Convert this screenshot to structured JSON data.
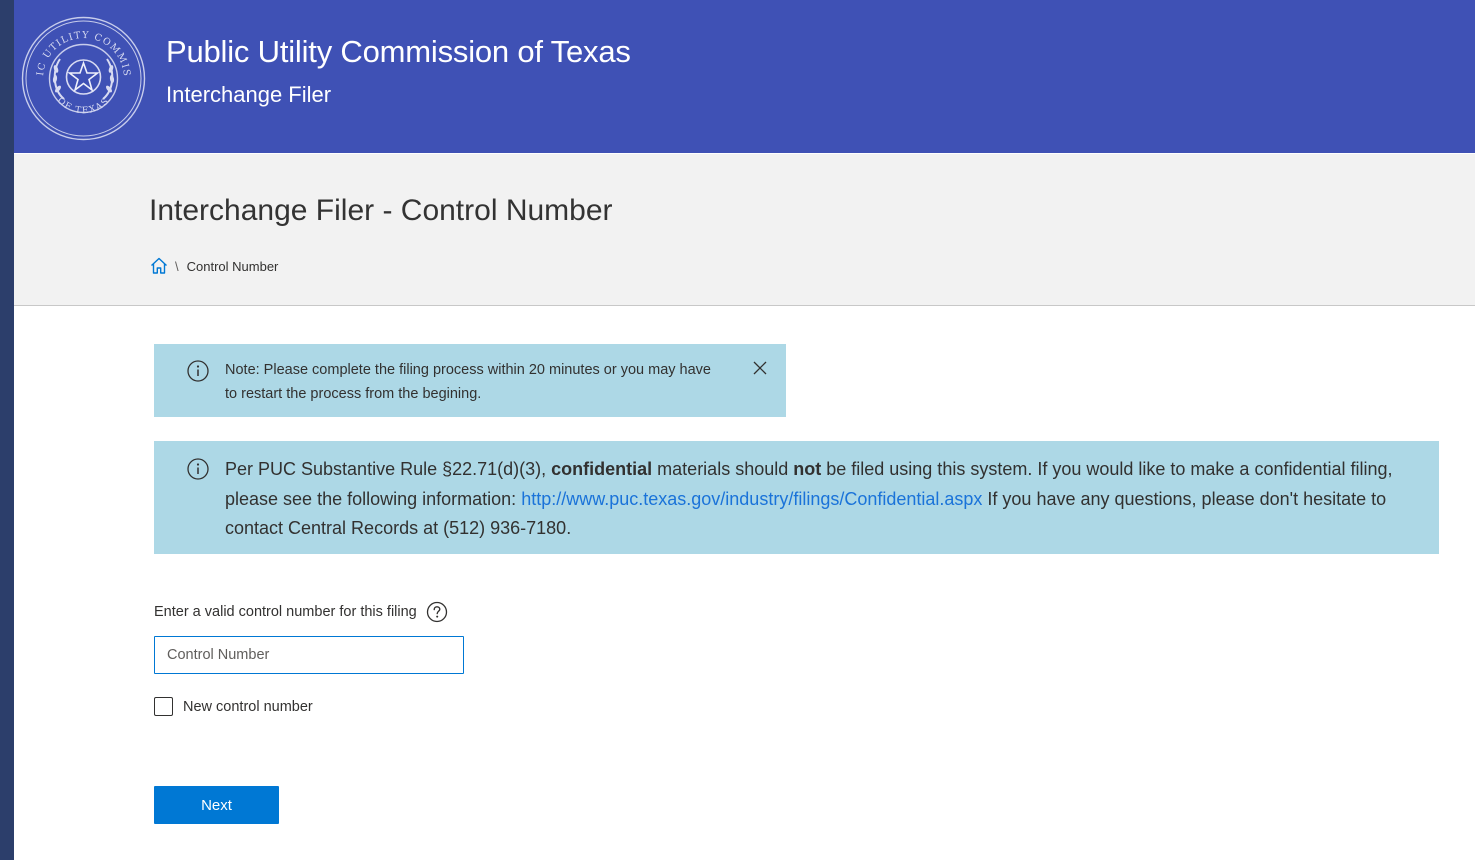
{
  "header": {
    "title": "Public Utility Commission of Texas",
    "subtitle": "Interchange Filer",
    "seal": {
      "icon": "state-seal-icon",
      "top_text": "PUBLIC UTILITY COMMISSION",
      "bottom_text": "OF TEXAS"
    }
  },
  "page": {
    "title": "Interchange Filer - Control Number",
    "breadcrumb": {
      "home_icon": "home-icon",
      "separator": "\\",
      "current": "Control Number"
    }
  },
  "notices": {
    "timeout": {
      "icon": "info-icon",
      "text": "Note: Please complete the filing process within 20 minutes or you may have to restart the process from the begining.",
      "close_icon": "close-icon"
    },
    "confidential": {
      "icon": "info-icon",
      "part1": "Per PUC Substantive Rule §22.71(d)(3), ",
      "bold1": "confidential",
      "part2": " materials should ",
      "bold2": "not",
      "part3": " be filed using this system. If you would like to make a confidential filing, please see the following information: ",
      "link": "http://www.puc.texas.gov/industry/filings/Confidential.aspx",
      "part4": " If you have any questions, please don't hesitate to contact Central Records at (512) 936-7180."
    }
  },
  "form": {
    "label": "Enter a valid control number for this filing",
    "help_icon": "help-icon",
    "input_value": "",
    "input_placeholder": "Control Number",
    "checkbox_label": "New control number",
    "checkbox_checked": false,
    "submit_label": "Next"
  },
  "colors": {
    "header_bg": "#3f51b5",
    "titlebar_bg": "#f2f2f2",
    "notice_bg": "#add8e6",
    "primary": "#0078d4",
    "link": "#1a73d9"
  }
}
